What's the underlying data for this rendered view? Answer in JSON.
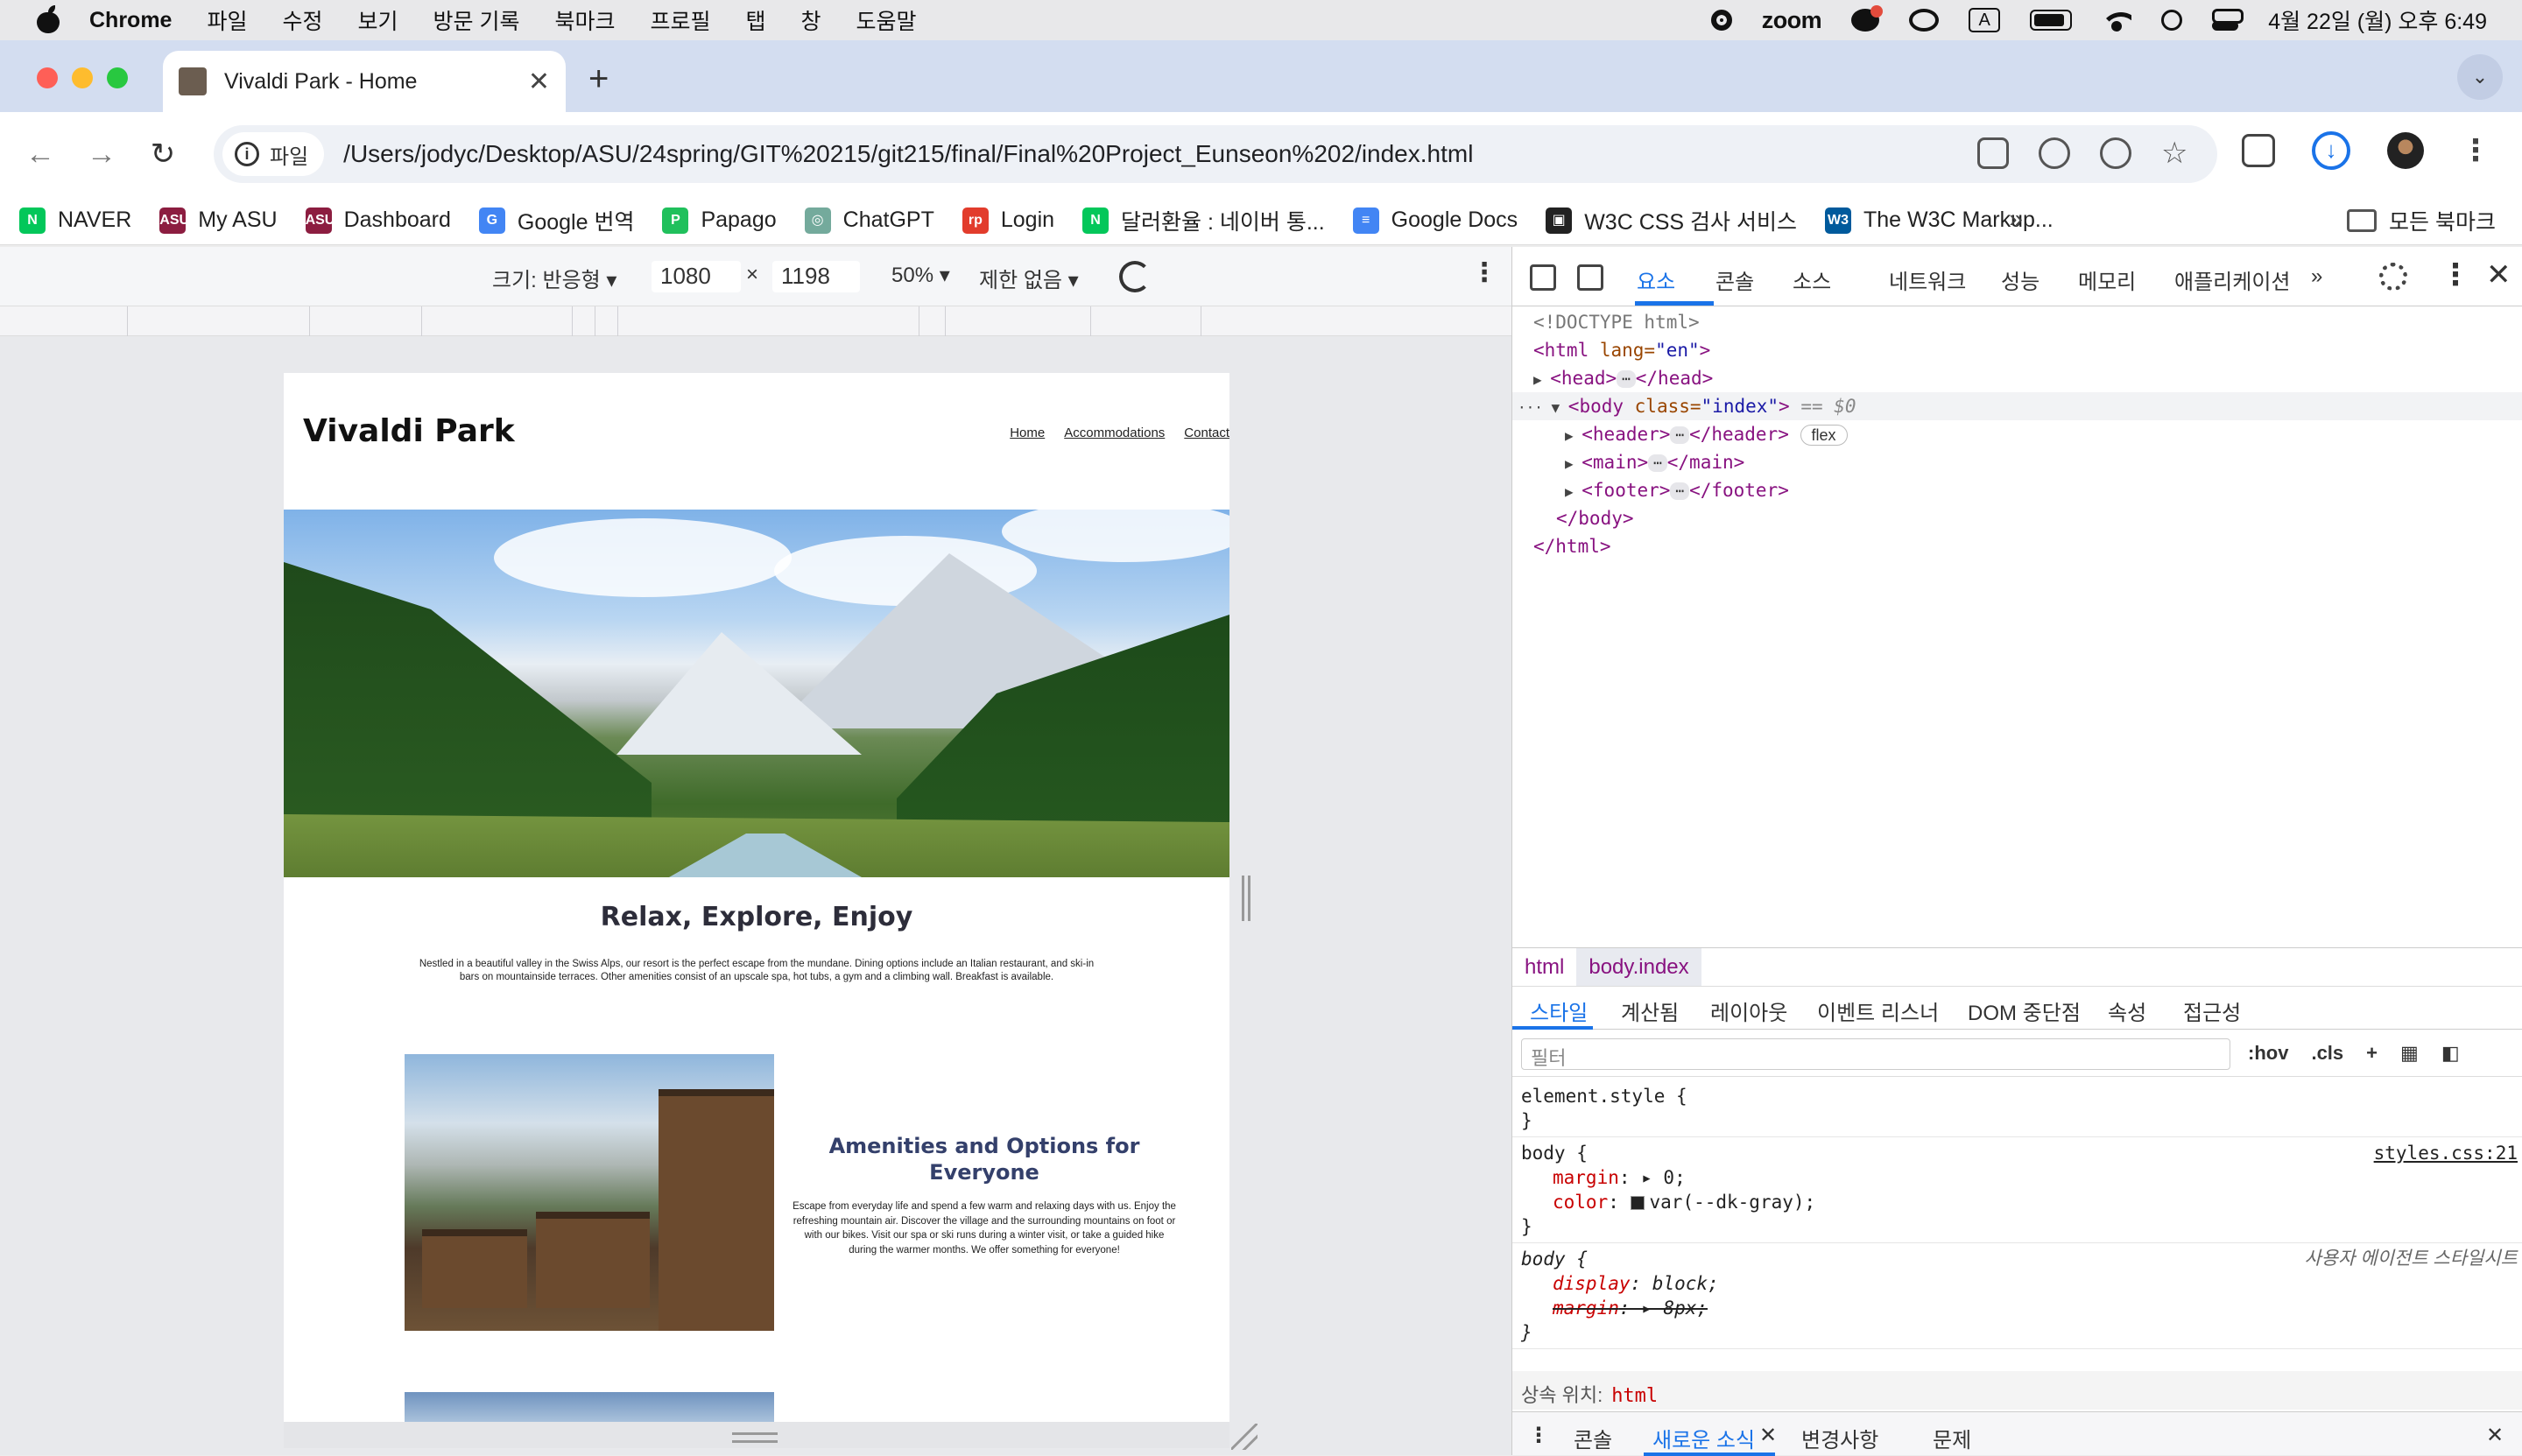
{
  "menubar": {
    "app": "Chrome",
    "items": [
      "파일",
      "수정",
      "보기",
      "방문 기록",
      "북마크",
      "프로필",
      "탭",
      "창",
      "도움말"
    ],
    "zoom_label": "zoom",
    "input_label": "A",
    "clock": "4월 22일 (월) 오후 6:49"
  },
  "browser": {
    "tab_title": "Vivaldi Park - Home",
    "new_tab": "+",
    "chip_label": "파일",
    "url": "/Users/jodyc/Desktop/ASU/24spring/GIT%20215/git215/final/Final%20Project_Eunseon%202/index.html",
    "bookmarks": [
      {
        "label": "NAVER",
        "color": "#03c75a",
        "glyph": "N"
      },
      {
        "label": "My ASU",
        "color": "#8c1d40",
        "glyph": "ASU"
      },
      {
        "label": "Dashboard",
        "color": "#8c1d40",
        "glyph": "ASU"
      },
      {
        "label": "Google 번역",
        "color": "#4285f4",
        "glyph": "G"
      },
      {
        "label": "Papago",
        "color": "#20c05c",
        "glyph": "P"
      },
      {
        "label": "ChatGPT",
        "color": "#74aa9c",
        "glyph": "◎"
      },
      {
        "label": "Login",
        "color": "#e23c2c",
        "glyph": "rp"
      },
      {
        "label": "달러환율 : 네이버 통...",
        "color": "#03c75a",
        "glyph": "N"
      },
      {
        "label": "Google Docs",
        "color": "#4285f4",
        "glyph": "≡"
      },
      {
        "label": "W3C CSS 검사 서비스",
        "color": "#222222",
        "glyph": "▣"
      },
      {
        "label": "The W3C Markup...",
        "color": "#005a9c",
        "glyph": "W3"
      }
    ],
    "more": "»",
    "all_bookmarks": "모든 북마크"
  },
  "device_toolbar": {
    "size_label": "크기: 반응형 ▾",
    "width": "1080",
    "times": "×",
    "height": "1198",
    "zoom": "50% ▾",
    "throttle": "제한 없음 ▾"
  },
  "site": {
    "title": "Vivaldi Park",
    "nav": [
      "Home",
      "Accommodations",
      "Contact"
    ],
    "tagline": "Relax, Explore, Enjoy",
    "intro": "Nestled in a beautiful valley in the Swiss Alps, our resort is the perfect escape from the mundane. Dining options include an Italian restaurant, and ski-in bars on mountainside terraces. Other amenities consist of an upscale spa, hot tubs, a gym and a climbing wall. Breakfast is available.",
    "amenities_title": "Amenities and Options for Everyone",
    "amenities_text": "Escape from everyday life and spend a few warm and relaxing days with us. Enjoy the refreshing mountain air. Discover the village and the surrounding mountains on foot or with our bikes. Visit our spa or ski runs during a winter visit, or take a guided hike during the warmer months. We offer something for everyone!"
  },
  "devtools": {
    "tabs": [
      "요소",
      "콘솔",
      "소스",
      "네트워크",
      "성능",
      "메모리",
      "애플리케이션"
    ],
    "more_tabs": "»",
    "dom": {
      "doctype": "<!DOCTYPE html>",
      "html_open_tag": "<html",
      "html_attr": " lang=",
      "html_attr_val": "\"en\"",
      "html_close_bracket": ">",
      "head_open": "<head>",
      "head_close": "</head>",
      "body_open": "<body",
      "body_attr": " class=",
      "body_attr_val": "\"index\"",
      "body_eq": " == $0",
      "header_open": "<header>",
      "header_close": "</header>",
      "flex_badge": "flex",
      "main_open": "<main>",
      "main_close": "</main>",
      "footer_open": "<footer>",
      "footer_close": "</footer>",
      "body_close": "</body>",
      "html_close": "</html>",
      "ellipsis": "⋯"
    },
    "breadcrumbs": [
      "html",
      "body.index"
    ],
    "pane_tabs": [
      "스타일",
      "계산됨",
      "레이아웃",
      "이벤트 리스너",
      "DOM 중단점",
      "속성",
      "접근성"
    ],
    "filter_placeholder": "필터",
    "filter_tools": [
      ":hov",
      ".cls",
      "+"
    ],
    "styles": {
      "element_style": "element.style {",
      "close": "}",
      "rule1_selector": "body {",
      "rule1_source": "styles.css:21",
      "rule1_margin_prop": "margin",
      "rule1_margin_val": ": ▸ 0;",
      "rule1_color_prop": "color",
      "rule1_color_val": "var(--dk-gray);",
      "rule2_selector": "body {",
      "rule2_source": "사용자 에이전트 스타일시트",
      "rule2_display_prop": "display",
      "rule2_display_val": ": block;",
      "rule2_margin_prop": "margin",
      "rule2_margin_val": ": ▸ 8px;"
    },
    "inherited_label": "상속 위치:",
    "inherited_tag": "html",
    "drawer": [
      "콘솔",
      "새로운 소식",
      "변경사항",
      "문제"
    ]
  }
}
